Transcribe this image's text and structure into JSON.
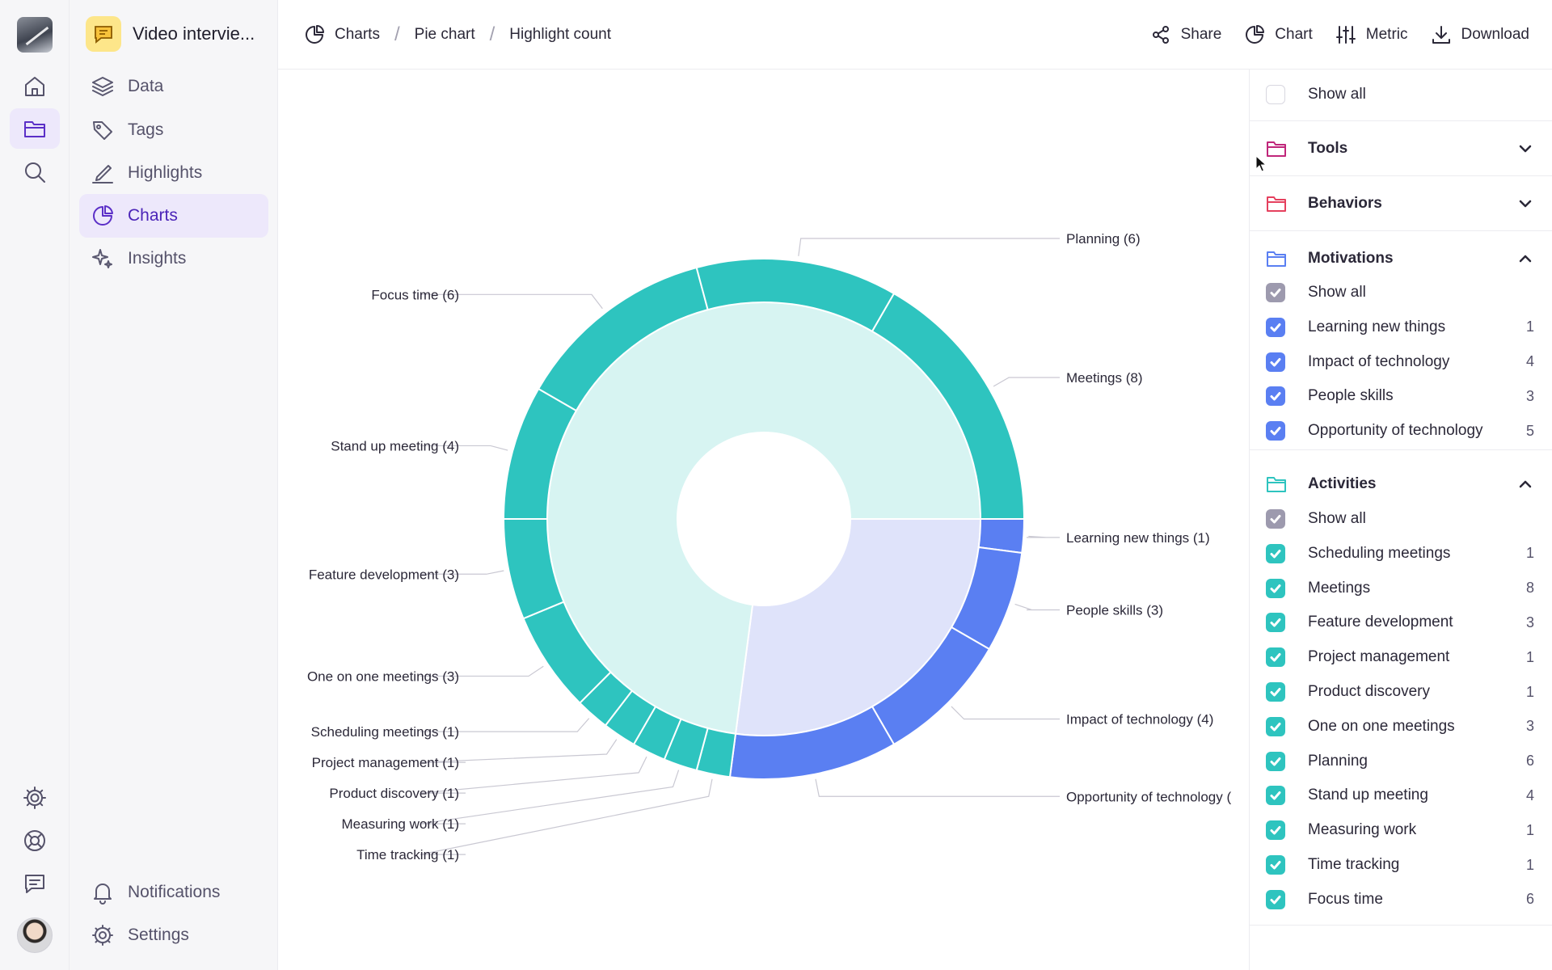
{
  "colors": {
    "teal": "#2ec4bf",
    "teal_light": "#d7f4f2",
    "blue": "#5a7ff2",
    "blue_light": "#dfe3fa",
    "accent": "#5b2fc7"
  },
  "rail": {
    "icons": [
      "home-icon",
      "folder-icon",
      "search-icon",
      "settings-icon",
      "help-icon",
      "feedback-icon"
    ]
  },
  "sidebar": {
    "project_title": "Video intervie...",
    "items": [
      {
        "label": "Data",
        "icon": "layers-icon"
      },
      {
        "label": "Tags",
        "icon": "tags-icon"
      },
      {
        "label": "Highlights",
        "icon": "highlighter-icon"
      },
      {
        "label": "Charts",
        "icon": "pie-chart-icon",
        "active": true
      },
      {
        "label": "Insights",
        "icon": "sparkles-icon"
      }
    ],
    "bottom": [
      {
        "label": "Notifications",
        "icon": "bell-icon"
      },
      {
        "label": "Settings",
        "icon": "gear-icon"
      }
    ]
  },
  "topbar": {
    "breadcrumbs": [
      "Charts",
      "Pie chart",
      "Highlight count"
    ],
    "actions": {
      "share": "Share",
      "chart": "Chart",
      "metric": "Metric",
      "download": "Download"
    }
  },
  "panel": {
    "show_all_top": "Show all",
    "sections": [
      {
        "name": "Tools",
        "color": "#c0267a",
        "expanded": false
      },
      {
        "name": "Behaviors",
        "color": "#e5405e",
        "expanded": false
      },
      {
        "name": "Motivations",
        "color": "#5a7ff2",
        "expanded": true,
        "check_color": "#5a7ff2",
        "show_all": "Show all",
        "items": [
          {
            "label": "Learning new things",
            "count": "1"
          },
          {
            "label": "Impact of technology",
            "count": "4"
          },
          {
            "label": "People skills",
            "count": "3"
          },
          {
            "label": "Opportunity of technology",
            "count": "5"
          }
        ]
      },
      {
        "name": "Activities",
        "color": "#2ec4bf",
        "expanded": true,
        "check_color": "#2ec4bf",
        "show_all": "Show all",
        "items": [
          {
            "label": "Scheduling meetings",
            "count": "1"
          },
          {
            "label": "Meetings",
            "count": "8"
          },
          {
            "label": "Feature development",
            "count": "3"
          },
          {
            "label": "Project management",
            "count": "1"
          },
          {
            "label": "Product discovery",
            "count": "1"
          },
          {
            "label": "One on one meetings",
            "count": "3"
          },
          {
            "label": "Planning",
            "count": "6"
          },
          {
            "label": "Stand up meeting",
            "count": "4"
          },
          {
            "label": "Measuring work",
            "count": "1"
          },
          {
            "label": "Time tracking",
            "count": "1"
          },
          {
            "label": "Focus time",
            "count": "6"
          }
        ]
      }
    ]
  },
  "chart_data": {
    "type": "pie",
    "subtype": "sunburst",
    "inner": [
      {
        "name": "Activities",
        "value": 35
      },
      {
        "name": "Motivations",
        "value": 13
      }
    ],
    "outer": [
      {
        "label": "Learning new things (1)",
        "name": "Learning new things",
        "value": 1,
        "group": "Motivations"
      },
      {
        "label": "People skills (3)",
        "name": "People skills",
        "value": 3,
        "group": "Motivations"
      },
      {
        "label": "Impact of technology (4)",
        "name": "Impact of technology",
        "value": 4,
        "group": "Motivations"
      },
      {
        "label": "Opportunity of technology (",
        "name": "Opportunity of technology",
        "value": 5,
        "group": "Motivations"
      },
      {
        "label": "Time tracking (1)",
        "name": "Time tracking",
        "value": 1,
        "group": "Activities"
      },
      {
        "label": "Measuring work (1)",
        "name": "Measuring work",
        "value": 1,
        "group": "Activities"
      },
      {
        "label": "Product discovery (1)",
        "name": "Product discovery",
        "value": 1,
        "group": "Activities"
      },
      {
        "label": "Project management (1)",
        "name": "Project management",
        "value": 1,
        "group": "Activities"
      },
      {
        "label": "Scheduling meetings (1)",
        "name": "Scheduling meetings",
        "value": 1,
        "group": "Activities"
      },
      {
        "label": "One on one meetings (3)",
        "name": "One on one meetings",
        "value": 3,
        "group": "Activities"
      },
      {
        "label": "Feature development (3)",
        "name": "Feature development",
        "value": 3,
        "group": "Activities"
      },
      {
        "label": "Stand up meeting (4)",
        "name": "Stand up meeting",
        "value": 4,
        "group": "Activities"
      },
      {
        "label": "Focus time (6)",
        "name": "Focus time",
        "value": 6,
        "group": "Activities"
      },
      {
        "label": "Planning (6)",
        "name": "Planning",
        "value": 6,
        "group": "Activities"
      },
      {
        "label": "Meetings (8)",
        "name": "Meetings",
        "value": 8,
        "group": "Activities"
      }
    ]
  }
}
